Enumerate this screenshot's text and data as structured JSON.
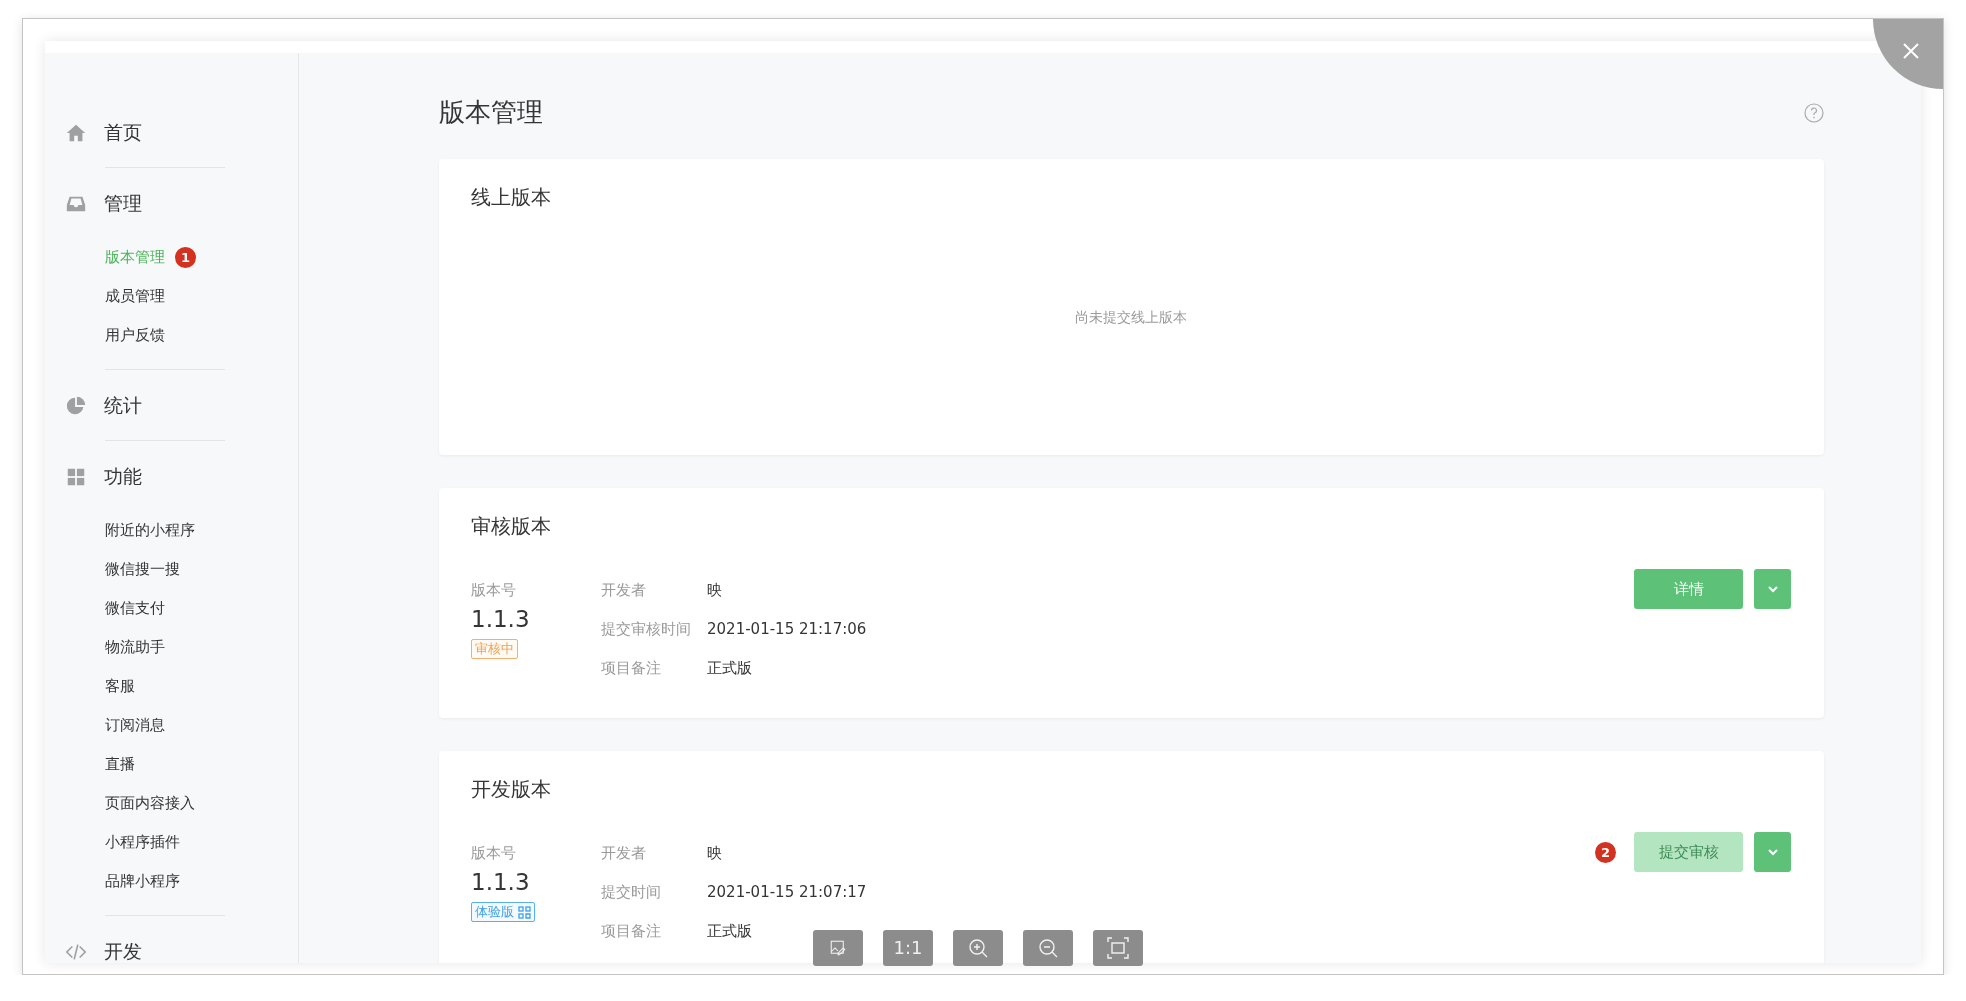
{
  "sidebar": {
    "sections": [
      {
        "label": "首页"
      },
      {
        "label": "管理",
        "children": [
          {
            "label": "版本管理",
            "selected": true,
            "badge": "1"
          },
          {
            "label": "成员管理",
            "selected": false
          },
          {
            "label": "用户反馈",
            "selected": false
          }
        ]
      },
      {
        "label": "统计"
      },
      {
        "label": "功能",
        "children": [
          {
            "label": "附近的小程序",
            "selected": false
          },
          {
            "label": "微信搜一搜",
            "selected": false
          },
          {
            "label": "微信支付",
            "selected": false
          },
          {
            "label": "物流助手",
            "selected": false
          },
          {
            "label": "客服",
            "selected": false
          },
          {
            "label": "订阅消息",
            "selected": false
          },
          {
            "label": "直播",
            "selected": false
          },
          {
            "label": "页面内容接入",
            "selected": false
          },
          {
            "label": "小程序插件",
            "selected": false
          },
          {
            "label": "品牌小程序",
            "selected": false
          }
        ]
      },
      {
        "label": "开发"
      }
    ]
  },
  "page_title": "版本管理",
  "online": {
    "title": "线上版本",
    "empty_text": "尚未提交线上版本"
  },
  "versions": [
    {
      "title": "审核版本",
      "version_label": "版本号",
      "version": "1.1.3",
      "tag": {
        "label": "审核中",
        "kind": "reviewing"
      },
      "fields": [
        {
          "label": "开发者",
          "value": "映"
        },
        {
          "label": "提交审核时间",
          "value": "2021-01-15 21:17:06"
        },
        {
          "label": "项目备注",
          "value": "正式版"
        }
      ],
      "button": {
        "label": "详情",
        "disabled": false
      }
    },
    {
      "title": "开发版本",
      "version_label": "版本号",
      "version": "1.1.3",
      "tag": {
        "label": "体验版",
        "kind": "trial"
      },
      "fields": [
        {
          "label": "开发者",
          "value": "映"
        },
        {
          "label": "提交时间",
          "value": "2021-01-15 21:07:17"
        },
        {
          "label": "项目备注",
          "value": "正式版"
        }
      ],
      "button": {
        "label": "提交审核",
        "disabled": true
      },
      "badge": "2"
    }
  ],
  "viewer_toolbar": [
    {
      "kind": "edit-image"
    },
    {
      "kind": "text",
      "label": "1:1"
    },
    {
      "kind": "zoom-in"
    },
    {
      "kind": "zoom-out"
    },
    {
      "kind": "fit"
    }
  ]
}
